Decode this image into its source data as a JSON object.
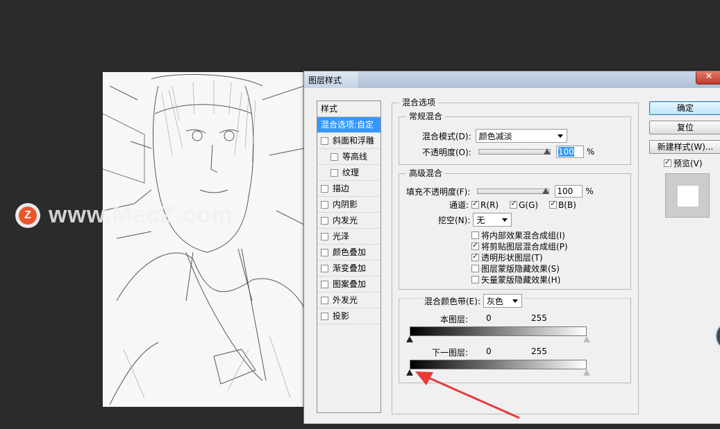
{
  "watermark": {
    "logo_letter": "Z",
    "text": "www.MacZ.com"
  },
  "dialog": {
    "title": "图层样式",
    "close_glyph": "✕",
    "styles_panel": {
      "header": "样式",
      "items": [
        {
          "label": "混合选项:自定",
          "checkbox": false,
          "active": true
        },
        {
          "label": "斜面和浮雕",
          "checkbox": true,
          "checked": false
        },
        {
          "label": "等高线",
          "checkbox": true,
          "checked": false,
          "indent": true
        },
        {
          "label": "纹理",
          "checkbox": true,
          "checked": false,
          "indent": true
        },
        {
          "label": "描边",
          "checkbox": true,
          "checked": false
        },
        {
          "label": "内阴影",
          "checkbox": true,
          "checked": false
        },
        {
          "label": "内发光",
          "checkbox": true,
          "checked": false
        },
        {
          "label": "光泽",
          "checkbox": true,
          "checked": false
        },
        {
          "label": "颜色叠加",
          "checkbox": true,
          "checked": false
        },
        {
          "label": "渐变叠加",
          "checkbox": true,
          "checked": false
        },
        {
          "label": "图案叠加",
          "checkbox": true,
          "checked": false
        },
        {
          "label": "外发光",
          "checkbox": true,
          "checked": false
        },
        {
          "label": "投影",
          "checkbox": true,
          "checked": false
        }
      ]
    },
    "blend_options": {
      "title": "混合选项",
      "general": {
        "title": "常规混合",
        "mode_label": "混合模式(D):",
        "mode_value": "颜色减淡",
        "opacity_label": "不透明度(O):",
        "opacity_value": "100",
        "opacity_level": 100,
        "percent": "%"
      },
      "advanced": {
        "title": "高级混合",
        "fill_label": "填充不透明度(F):",
        "fill_value": "100",
        "fill_level": 100,
        "percent": "%",
        "channels_label": "通道:",
        "channel_r": "R(R)",
        "channel_g": "G(G)",
        "channel_b": "B(B)",
        "knockout_label": "挖空(N):",
        "knockout_value": "无",
        "options": [
          {
            "label": "将内部效果混合成组(I)",
            "checked": false
          },
          {
            "label": "将剪贴图层混合成组(P)",
            "checked": true
          },
          {
            "label": "透明形状图层(T)",
            "checked": true
          },
          {
            "label": "图层蒙版隐藏效果(S)",
            "checked": false
          },
          {
            "label": "矢量蒙版隐藏效果(H)",
            "checked": false
          }
        ]
      },
      "blend_if": {
        "label": "混合颜色带(E):",
        "value": "灰色",
        "this_layer_label": "本图层:",
        "this_layer_low": "0",
        "this_layer_high": "255",
        "underlying_label": "下一图层:",
        "underlying_low": "0",
        "underlying_high": "255"
      }
    },
    "buttons": {
      "ok": "确定",
      "reset": "复位",
      "new_style": "新建样式(W)...",
      "preview_label": "预览(V)",
      "preview_checked": true
    }
  },
  "colors": {
    "selection": "#3399ff",
    "annotation_arrow": "#e83a3a"
  }
}
